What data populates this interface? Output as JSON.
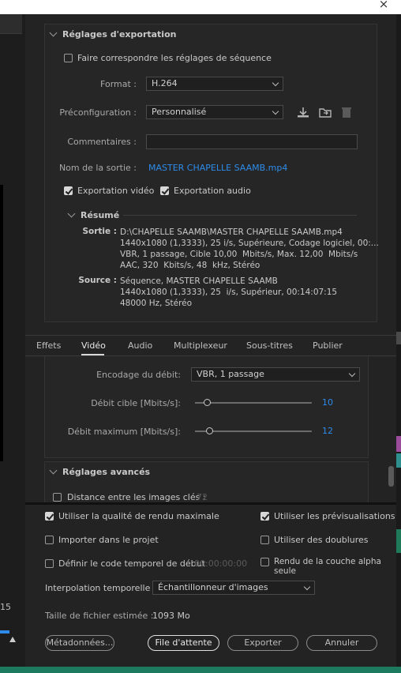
{
  "window": {
    "close_glyph": "×"
  },
  "left_panel": {
    "timecode": "15"
  },
  "export_settings": {
    "title": "Réglages d'exportation",
    "match_sequence": {
      "label": "Faire correspondre les réglages de séquence",
      "checked": false
    },
    "format": {
      "label": "Format :",
      "value": "H.264"
    },
    "preset": {
      "label": "Préconfiguration :",
      "value": "Personnalisé"
    },
    "comments": {
      "label": "Commentaires :",
      "value": ""
    },
    "output_name": {
      "label": "Nom de la sortie :",
      "value": "MASTER CHAPELLE SAAMB.mp4"
    },
    "export_video": {
      "label": "Exportation vidéo",
      "checked": true
    },
    "export_audio": {
      "label": "Exportation audio",
      "checked": true
    },
    "summary": {
      "title": "Résumé",
      "output_label": "Sortie :",
      "output_lines": [
        "D:\\CHAPELLE SAAMB\\MASTER CHAPELLE SAAMB.mp4",
        "1440x1080 (1,3333), 25 i/s, Supérieure, Codage logiciel, 00:...",
        "VBR, 1 passage, Cible 10,00  Mbits/s, Max. 12,00  Mbits/s",
        "AAC, 320  Kbits/s, 48  kHz, Stéréo"
      ],
      "source_label": "Source :",
      "source_lines": [
        "Séquence, MASTER CHAPELLE SAAMB",
        "1440x1080 (1,3333), 25  i/s, Supérieur, 00:14:07:15",
        "48000 Hz, Stéréo"
      ]
    }
  },
  "tabs": [
    {
      "label": "Effets",
      "active": false
    },
    {
      "label": "Vidéo",
      "active": true
    },
    {
      "label": "Audio",
      "active": false
    },
    {
      "label": "Multiplexeur",
      "active": false
    },
    {
      "label": "Sous-titres",
      "active": false
    },
    {
      "label": "Publier",
      "active": false
    }
  ],
  "video": {
    "bitrate_encoding": {
      "label": "Encodage du débit:",
      "value": "VBR, 1 passage"
    },
    "target_bitrate": {
      "label": "Débit cible [Mbits/s]:",
      "value": "10",
      "fraction": 0.1
    },
    "max_bitrate": {
      "label": "Débit maximum [Mbits/s]:",
      "value": "12",
      "fraction": 0.12
    }
  },
  "advanced": {
    "title": "Réglages avancés",
    "keyframe_distance": {
      "label": "Distance entre les images clés :",
      "value": "72",
      "checked": false
    }
  },
  "options": {
    "max_render_quality": {
      "label": "Utiliser la qualité de rendu maximale",
      "checked": true
    },
    "use_previews": {
      "label": "Utiliser les prévisualisations",
      "checked": true
    },
    "import_project": {
      "label": "Importer dans le projet",
      "checked": false
    },
    "use_proxies": {
      "label": "Utiliser des doublures",
      "checked": false
    },
    "set_start_timecode": {
      "label": "Définir le code temporel de début",
      "value": "00:00:00:00",
      "checked": false
    },
    "render_alpha": {
      "label": "Rendu de la couche alpha seule",
      "checked": false
    },
    "time_interpolation": {
      "label": "Interpolation temporelle :",
      "value": "Échantillonneur d'images"
    },
    "file_size": {
      "label": "Taille de fichier estimée :",
      "value": "1093 Mo"
    }
  },
  "buttons": {
    "metadata": "Métadonnées...",
    "queue": "File d'attente",
    "export": "Exporter",
    "cancel": "Annuler"
  },
  "colors": {
    "accent": "#2d8ceb",
    "background": "#232323"
  }
}
